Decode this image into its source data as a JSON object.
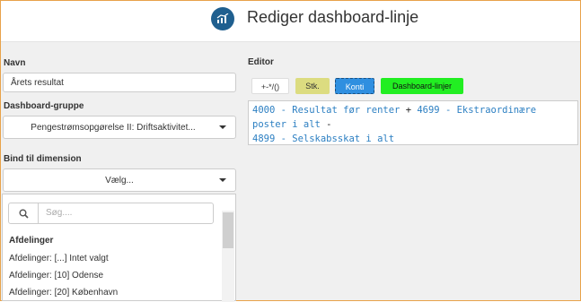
{
  "header": {
    "title": "Rediger dashboard-linje",
    "logo_icon": "chart-icon"
  },
  "form": {
    "navn_label": "Navn",
    "navn_value": "Årets resultat",
    "gruppe_label": "Dashboard-gruppe",
    "gruppe_value": "Pengestrømsopgørelse II: Driftsaktivitet...",
    "dimension_label": "Bind til dimension",
    "dimension_value": "Vælg..."
  },
  "dropdown": {
    "search_placeholder": "Søg....",
    "group_label": "Afdelinger",
    "options": [
      "Afdelinger: [...] Intet valgt",
      "Afdelinger: [10] Odense",
      "Afdelinger: [20] København"
    ]
  },
  "editor": {
    "label": "Editor",
    "buttons": {
      "operators": "+-*/()",
      "stk": "Stk.",
      "konti": "Konti",
      "dashboard": "Dashboard-linjer"
    },
    "line1": {
      "acc1": "4000 - Resultat før renter",
      "op1": " + ",
      "acc2": "4699 - Ekstraordinære poster i alt",
      "op2": " -"
    },
    "line2": {
      "acc3": "4899 - Selskabsskat i alt"
    }
  },
  "colors": {
    "stk_bg": "#dcdc80",
    "konti_bg": "#2f8fe0",
    "dashboard_bg": "#22ee22",
    "account_text": "#2c7fc2"
  }
}
